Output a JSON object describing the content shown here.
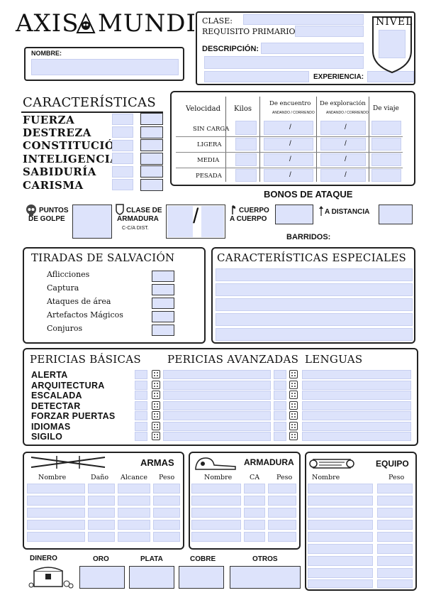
{
  "header": {
    "title_left": "AXIS",
    "title_right": "MUNDI",
    "nombre_label": "NOMBRE:",
    "clase_label": "CLASE:",
    "requisito_label": "REQUISITO PRIMARIO:",
    "descripcion_label": "DESCRIPCIÓN:",
    "experiencia_label": "EXPERIENCIA:",
    "nivel_label": "NIVEL"
  },
  "caracteristicas": {
    "title": "CARACTERÍSTICAS",
    "items": [
      "FUERZA",
      "DESTREZA",
      "CONSTITUCIÓN",
      "INTELIGENCIA",
      "SABIDURÍA",
      "CARISMA"
    ]
  },
  "movement": {
    "headers": [
      "Velocidad",
      "Kilos",
      "De encuentro",
      "De exploración",
      "De viaje"
    ],
    "subheaders": [
      "ANDANDO / CORRIENDO",
      "ANDANDO / CORRIENDO"
    ],
    "rows": [
      "SIN CARGA",
      "LIGERA",
      "MEDIA",
      "PESADA"
    ]
  },
  "combat": {
    "bonos_title": "BONOS DE ATAQUE",
    "puntos_label_1": "PUNTOS",
    "puntos_label_2": "DE GOLPE",
    "clase_label_1": "CLASE DE",
    "clase_label_2": "ARMADURA",
    "clase_sub": "C-C/A DIST.",
    "cuerpo_label_1": "CUERPO",
    "cuerpo_label_2": "A CUERPO",
    "distancia_label": "A DISTANCIA",
    "barridos_label": "BARRIDOS:"
  },
  "salvacion": {
    "title": "TIRADAS DE SALVACIÓN",
    "items": [
      "Aflicciones",
      "Captura",
      "Ataques de área",
      "Artefactos Mágicos",
      "Conjuros"
    ]
  },
  "especiales": {
    "title": "CARACTERÍSTICAS ESPECIALES"
  },
  "pericias": {
    "basicas_title": "PERICIAS BÁSICAS",
    "avanzadas_title": "PERICIAS AVANZADAS",
    "lenguas_title": "LENGUAS",
    "basicas": [
      "ALERTA",
      "ARQUITECTURA",
      "ESCALADA",
      "DETECTAR",
      "FORZAR PUERTAS",
      "IDIOMAS",
      "SIGILO"
    ]
  },
  "armas": {
    "title": "ARMAS",
    "columns": [
      "Nombre",
      "Daño",
      "Alcance",
      "Peso"
    ]
  },
  "armadura": {
    "title": "ARMADURA",
    "columns": [
      "Nombre",
      "CA",
      "Peso"
    ]
  },
  "equipo": {
    "title": "EQUIPO",
    "columns": [
      "Nombre",
      "Peso"
    ]
  },
  "dinero": {
    "title": "DINERO",
    "coins": [
      "ORO",
      "PLATA",
      "COBRE",
      "OTROS"
    ]
  },
  "colors": {
    "field_fill": "#dde3fb",
    "ink": "#111111"
  }
}
